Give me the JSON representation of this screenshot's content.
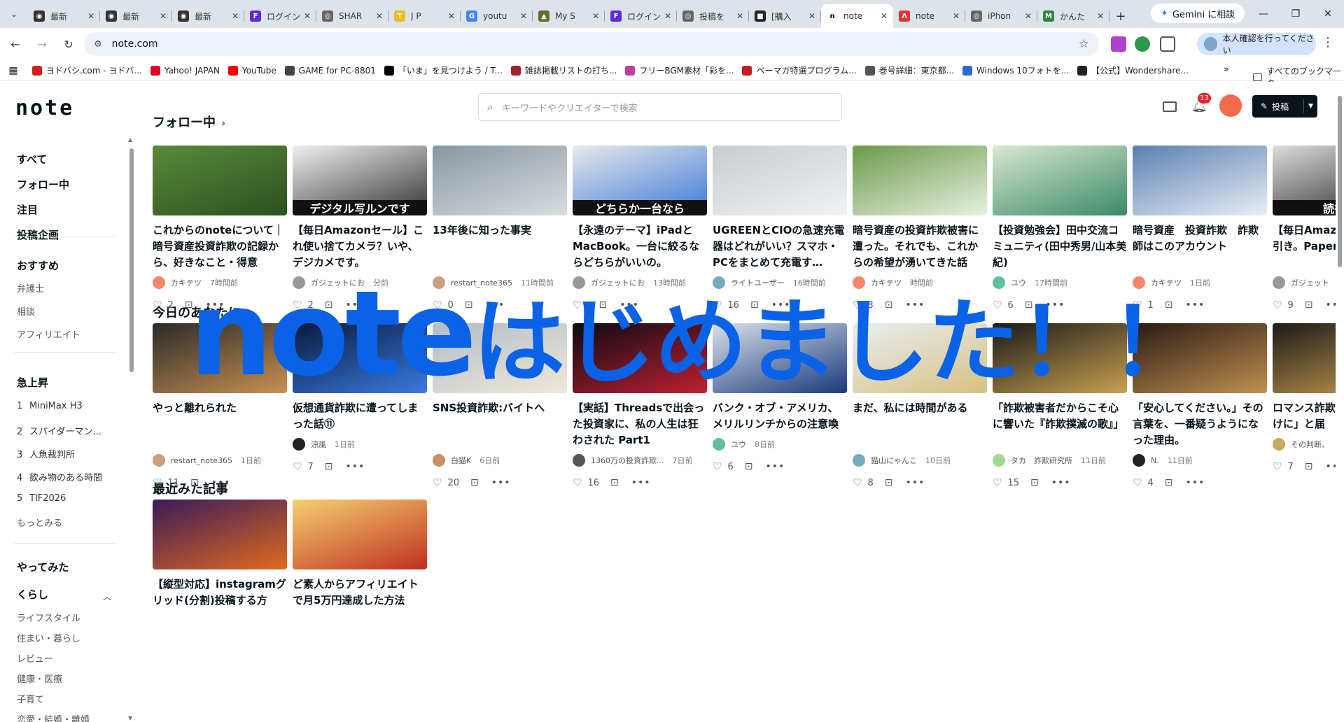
{
  "tabs": [
    {
      "label": "最新",
      "color": "#333",
      "glyph": "◉"
    },
    {
      "label": "最新",
      "color": "#333",
      "glyph": "◉"
    },
    {
      "label": "最新",
      "color": "#333",
      "glyph": "◉"
    },
    {
      "label": "ログイン",
      "color": "#5b2bd8",
      "glyph": "F"
    },
    {
      "label": "SHAR",
      "color": "#666",
      "glyph": "◎"
    },
    {
      "label": "J P",
      "color": "#e8c020",
      "glyph": "T"
    },
    {
      "label": "youtu",
      "color": "#4285f4",
      "glyph": "G"
    },
    {
      "label": "My S",
      "color": "#6a6a2a",
      "glyph": "▲"
    },
    {
      "label": "ログイン",
      "color": "#5b2bd8",
      "glyph": "F"
    },
    {
      "label": "投稿を",
      "color": "#666",
      "glyph": "◎"
    },
    {
      "label": "[購入",
      "color": "#222",
      "glyph": "■"
    },
    {
      "label": "note",
      "color": "#fff",
      "glyph": "n",
      "active": true
    },
    {
      "label": "note",
      "color": "#e0342c",
      "glyph": "Λ"
    },
    {
      "label": "iPhon",
      "color": "#666",
      "glyph": "◎"
    },
    {
      "label": "かんた",
      "color": "#2a8a3a",
      "glyph": "M"
    }
  ],
  "gemini_label": "Gemini に相談",
  "url": "note.com",
  "verify_label": "本人確認を行ってください",
  "bookmarks": [
    {
      "label": "ヨドバシ.com - ヨドバ...",
      "color": "#d02020"
    },
    {
      "label": "Yahoo! JAPAN",
      "color": "#e0002a"
    },
    {
      "label": "YouTube",
      "color": "#ff0000"
    },
    {
      "label": "GAME for PC-8801",
      "color": "#444"
    },
    {
      "label": "「いま」を見つけよう / T...",
      "color": "#000"
    },
    {
      "label": "雑誌掲載リストの打ち...",
      "color": "#a02030"
    },
    {
      "label": "フリーBGM素材「彩を...",
      "color": "#c040a0"
    },
    {
      "label": "ベーマガ特選プログラム...",
      "color": "#c02020"
    },
    {
      "label": "巻号詳細：東京都...",
      "color": "#555"
    },
    {
      "label": "Windows 10フォトを...",
      "color": "#2a6ad8"
    },
    {
      "label": "【公式】Wondershare...",
      "color": "#222"
    }
  ],
  "bookmarks_all": "すべてのブックマーク",
  "header": {
    "logo": "note",
    "search_placeholder": "キーワードやクリエイターで検索",
    "notif_count": "13",
    "post_label": "投稿"
  },
  "sidebar": {
    "main": [
      "すべて",
      "フォロー中",
      "注目",
      "投稿企画"
    ],
    "recommend_title": "おすすめ",
    "recommend": [
      "弁護士",
      "相談",
      "アフィリエイト"
    ],
    "trending_title": "急上昇",
    "trending": [
      {
        "n": "1",
        "t": "MiniMax H3"
      },
      {
        "n": "2",
        "t": "スパイダーマン..."
      },
      {
        "n": "3",
        "t": "人魚裁判所"
      },
      {
        "n": "4",
        "t": "飲み物のある時間"
      },
      {
        "n": "5",
        "t": "TIF2026"
      }
    ],
    "more": "もっとみる",
    "tried": "やってみた",
    "life": "くらし",
    "life_items": [
      "ライフスタイル",
      "住まい・暮らし",
      "レビュー",
      "健康・医療",
      "子育て",
      "恋愛・結婚・離婚"
    ]
  },
  "sections": {
    "following": "フォロー中",
    "for_you": "今日のあなたに",
    "recent": "最近みた記事"
  },
  "row1": [
    {
      "title": "これからのnoteについて｜暗号資産投資詐欺の記録から、好きなこと・得意",
      "user": "カキテツ",
      "time": "7時間前",
      "likes": "2",
      "thumb": "#5a8a3a",
      "thumb2": "#2d5020",
      "ua": "#f5876a"
    },
    {
      "title": "【毎日Amazonセール】これ使い捨てカメラ？いや、デジカメです。",
      "user": "ガジェットにお",
      "time": "分前",
      "likes": "2",
      "thumb": "#f0f0f0",
      "thumb2": "#333",
      "cap": "デジタル写ルンです",
      "ua": "#999"
    },
    {
      "title": "13年後に知った事実",
      "user": "restart_note365",
      "time": "11時間前",
      "likes": "0",
      "thumb": "#8a96a0",
      "thumb2": "#d8dde0",
      "ua": "#c8a080"
    },
    {
      "title": "【永遠のテーマ】iPadとMacBook。一台に絞るならどちらがいいの。",
      "user": "ガジェットにお",
      "time": "13時間前",
      "likes": "",
      "thumb": "#e8e8ea",
      "thumb2": "#3a7ad8",
      "cap": "どちらか一台なら",
      "ua": "#999"
    },
    {
      "title": "UGREENとCIOの急速充電器はどれがいい？スマホ・PCをまとめて充電す…",
      "user": "ライトユーザー",
      "time": "16時間前",
      "likes": "16",
      "thumb": "#c8ccd0",
      "thumb2": "#f0f2f4",
      "ua": "#7ab"
    },
    {
      "title": "暗号資産の投資詐欺被害に遭った。それでも、これからの希望が湧いてきた話",
      "user": "カキテツ",
      "time": "時間前",
      "likes": "3",
      "thumb": "#6a9a4a",
      "thumb2": "#e8f0e0",
      "ua": "#f5876a"
    },
    {
      "title": "【投資勉強会】田中交流コミュニティ(田中秀男/山本美紀)",
      "user": "ユウ",
      "time": "17時間前",
      "likes": "6",
      "thumb": "#d8e8d0",
      "thumb2": "#3a8a6a",
      "ua": "#5fc0a0"
    },
    {
      "title": "暗号資産　投資詐欺　詐欺師はこのアカウント",
      "user": "カキテツ",
      "time": "1日前",
      "likes": "1",
      "thumb": "#5a80b0",
      "thumb2": "#e8eef6",
      "ua": "#f5876a"
    },
    {
      "title": "【毎日Amazon】突然の値引き。Paperwhite",
      "user": "ガジェット",
      "time": "",
      "likes": "9",
      "thumb": "#ddd",
      "thumb2": "#222",
      "cap": "読書好",
      "ua": "#999"
    }
  ],
  "row2": [
    {
      "title": "やっと離れられた",
      "user": "restart_note365",
      "time": "1日前",
      "likes": "11",
      "thumb": "#2a2a2a",
      "thumb2": "#c89050",
      "ua": "#c8a080"
    },
    {
      "title": "仮想通貨詐欺に遭ってしまった話⑪",
      "user": "涼風",
      "time": "1日前",
      "likes": "7",
      "thumb": "#0a1a3a",
      "thumb2": "#3a7ae0",
      "ua": "#222"
    },
    {
      "title": "SNS投資詐欺:バイトへ",
      "user": "白猫K",
      "time": "6日前",
      "likes": "20",
      "thumb": "#b0bcc8",
      "thumb2": "#f0e8d8",
      "ua": "#c89060"
    },
    {
      "title": "【実話】Threadsで出会った投資家に、私の人生は狂わされた Part1",
      "user": "1360万の投資詐欺...",
      "time": "7日前",
      "likes": "16",
      "thumb": "#0a0a14",
      "thumb2": "#c02030",
      "ua": "#555"
    },
    {
      "title": "バンク・オブ・アメリカ、メリルリンチからの注意喚起",
      "user": "ユウ",
      "time": "8日前",
      "likes": "6",
      "thumb": "#d8e0ea",
      "thumb2": "#1a3a7a",
      "ua": "#5fc0a0"
    },
    {
      "title": "まだ、私には時間がある",
      "user": "猫山にゃんこ",
      "time": "10日前",
      "likes": "8",
      "thumb": "#e8eef4",
      "thumb2": "#d8c080",
      "ua": "#7ab"
    },
    {
      "title": "「詐欺被害者だからこそ心に響いた『詐欺撲滅の歌』」",
      "user": "タカ　詐欺研究所",
      "time": "11日前",
      "likes": "15",
      "thumb": "#1a1a1a",
      "thumb2": "#c8a050",
      "ua": "#a0d890"
    },
    {
      "title": "「安心してください。」その言葉を、一番疑うようになった理由。",
      "user": "N.",
      "time": "11日前",
      "likes": "4",
      "thumb": "#2a1a14",
      "thumb2": "#c09050",
      "ua": "#222"
    },
    {
      "title": "ロマンス詐欺いた直後、「かけに」と届",
      "user": "その判断、",
      "time": "",
      "likes": "7",
      "thumb": "#1a1a1a",
      "thumb2": "#d0a050",
      "ua": "#c8a860"
    }
  ],
  "row3": [
    {
      "title": "【縦型対応】instagramグリッド(分割)投稿する方",
      "thumb": "#3a1a5a",
      "thumb2": "#e06a20"
    },
    {
      "title": "ど素人からアフィリエイトで月5万円達成した方法",
      "thumb": "#f5d070",
      "thumb2": "#c03020"
    }
  ],
  "overlay": {
    "a": "note",
    "b": "はじめました！！"
  }
}
